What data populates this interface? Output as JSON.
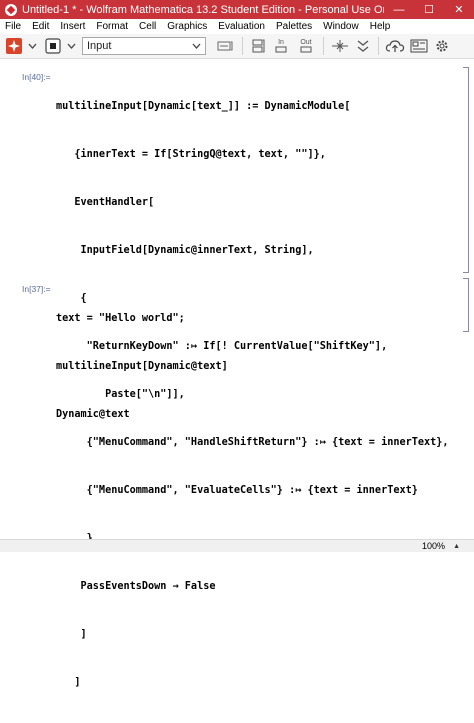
{
  "window": {
    "title": "Untitled-1 * - Wolfram Mathematica 13.2 Student Edition - Personal Use Only",
    "minimize": "—",
    "maximize": "☐",
    "close": "✕"
  },
  "menu": [
    "File",
    "Edit",
    "Insert",
    "Format",
    "Cell",
    "Graphics",
    "Evaluation",
    "Palettes",
    "Window",
    "Help"
  ],
  "toolbar": {
    "style_value": "Input",
    "in_label": "In",
    "out_label": "Out",
    "icons": [
      "evaluate-icon",
      "chevron-down-icon",
      "abort-icon",
      "chevron-down-icon",
      "style-chevron-icon",
      "cell-format-icon",
      "cell-group-icon",
      "in-out-icon",
      "split-icon",
      "merge-icon",
      "cloud-icon",
      "image-icon",
      "gear-icon"
    ]
  },
  "cells": [
    {
      "label": "In[40]:=",
      "lines": [
        "multilineInput[Dynamic[text_]] := DynamicModule[",
        "   {innerText = If[StringQ@text, text, \"\"]},",
        "   EventHandler[",
        "    InputField[Dynamic@innerText, String],",
        "    {",
        "     \"ReturnKeyDown\" :↦ If[! CurrentValue[\"ShiftKey\"],",
        "        Paste[\"\\n\"]],",
        "     {\"MenuCommand\", \"HandleShiftReturn\"} :↦ {text = innerText},",
        "     {\"MenuCommand\", \"EvaluateCells\"} :↦ {text = innerText}",
        "     },",
        "    PassEventsDown → False",
        "    ]",
        "   ]"
      ]
    },
    {
      "label": "In[37]:=",
      "lines": [
        "text = \"Hello world\";",
        "multilineInput[Dynamic@text]",
        "Dynamic@text"
      ]
    }
  ],
  "status": {
    "zoom": "100%",
    "zoom_arrow": "▲"
  }
}
